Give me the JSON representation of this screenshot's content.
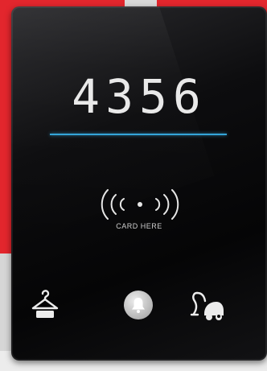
{
  "room_number": "4356",
  "card_label": "CARD HERE",
  "icons": {
    "laundry": "hanger-icon",
    "bell": "bell-icon",
    "cleaning": "vacuum-cleaner-icon",
    "rfid": "rfid-waves-icon"
  },
  "colors": {
    "accent_line": "#34a5d9",
    "panel": "#0a0a0b",
    "background_red": "#e3262d"
  }
}
